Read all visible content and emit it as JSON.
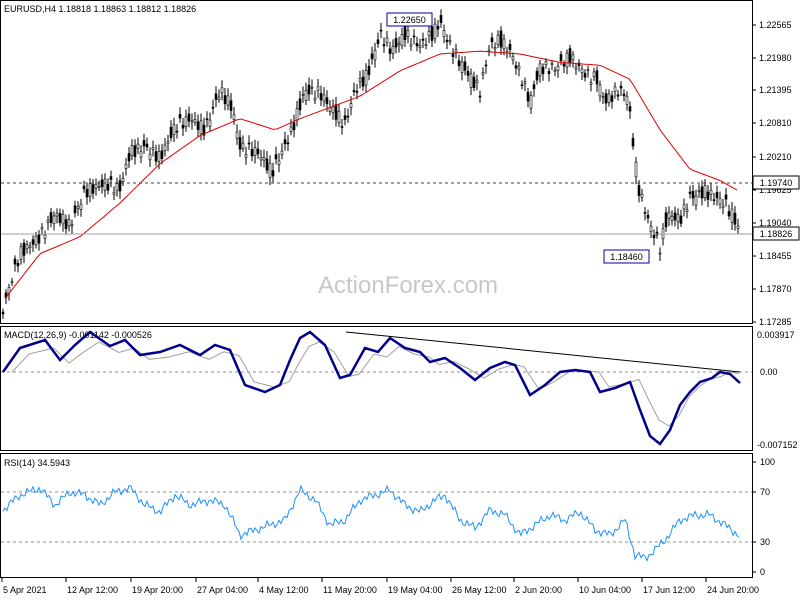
{
  "header": {
    "price": "EURUSD,H4  1.18818 1.18863 1.18812 1.18826",
    "macd": "MACD(12,26,9) -0.001142 -0.000526",
    "rsi": "RSI(14) 34.5943"
  },
  "watermark": "ActionForex.com",
  "colors": {
    "candle": "#000000",
    "ma": "#e00000",
    "macd_main": "#00008b",
    "macd_signal": "#a0a0a0",
    "rsi": "#1e90ff",
    "grid_dash": "#909090"
  },
  "price_axis": {
    "ticks": [
      "1.22565",
      "1.21980",
      "1.21395",
      "1.20810",
      "1.20210",
      "1.19625",
      "1.19040",
      "1.18455",
      "1.17870",
      "1.17285"
    ],
    "ymin": 1.17285,
    "ymax": 1.22565
  },
  "annotations": {
    "high": "1.22650",
    "low": "1.18460",
    "level": "1.19740",
    "last": "1.18826"
  },
  "macd_axis": {
    "top": "0.003917",
    "zero": "0.00",
    "bottom": "-0.007152"
  },
  "rsi_axis": {
    "ticks": [
      "100",
      "70",
      "30",
      "0"
    ]
  },
  "x_axis": {
    "labels": [
      "5 Apr 2021",
      "12 Apr 12:00",
      "19 Apr 20:00",
      "27 Apr 04:00",
      "4 May 12:00",
      "11 May 20:00",
      "19 May 04:00",
      "26 May 12:00",
      "2 Jun 20:00",
      "10 Jun 04:00",
      "17 Jun 12:00",
      "24 Jun 20:00"
    ]
  },
  "chart_data": {
    "type": "line",
    "title": "EURUSD,H4",
    "x": [
      "5 Apr 2021",
      "12 Apr 12:00",
      "19 Apr 20:00",
      "27 Apr 04:00",
      "4 May 12:00",
      "11 May 20:00",
      "19 May 04:00",
      "26 May 12:00",
      "2 Jun 20:00",
      "10 Jun 04:00",
      "17 Jun 12:00",
      "24 Jun 20:00"
    ],
    "series": [
      {
        "name": "EURUSD",
        "values": [
          1.176,
          1.196,
          1.2035,
          1.209,
          1.204,
          1.214,
          1.225,
          1.22,
          1.215,
          1.215,
          1.19,
          1.194
        ]
      },
      {
        "name": "MACD(12,26,9)",
        "values": [
          0.0005,
          0.002,
          0.0015,
          0.0018,
          -0.0018,
          0.003,
          0.0025,
          0.0005,
          0.0,
          -0.0015,
          -0.0065,
          0.0
        ]
      },
      {
        "name": "RSI(14)",
        "values": [
          50,
          72,
          72,
          62,
          36,
          68,
          72,
          55,
          52,
          60,
          18,
          60
        ]
      }
    ],
    "ylim": [
      1.17285,
      1.22565
    ]
  }
}
